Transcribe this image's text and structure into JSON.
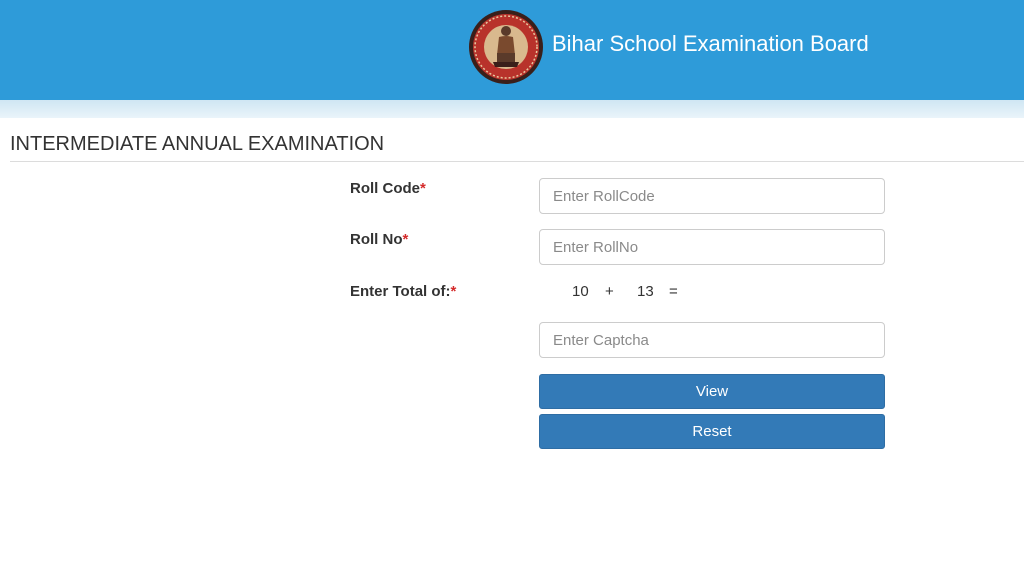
{
  "header": {
    "board_title": "Bihar School Examination Board",
    "logo_icon": "bseb-emblem-icon",
    "background_color": "#2e9bd9"
  },
  "section": {
    "title": "INTERMEDIATE ANNUAL EXAMINATION"
  },
  "form": {
    "roll_code": {
      "label": "Roll Code",
      "required_mark": "*",
      "value": "",
      "placeholder": "Enter RollCode"
    },
    "roll_no": {
      "label": "Roll No",
      "required_mark": "*",
      "value": "",
      "placeholder": "Enter RollNo"
    },
    "captcha": {
      "label": "Enter Total of:",
      "required_mark": "*",
      "operand_a": "10",
      "operator": "+",
      "operand_b": "13",
      "equals": "=",
      "value": "",
      "placeholder": "Enter Captcha"
    },
    "view_button": {
      "label": "View"
    },
    "reset_button": {
      "label": "Reset"
    },
    "button_color": "#337ab7",
    "required_color": "#d42a2a"
  }
}
